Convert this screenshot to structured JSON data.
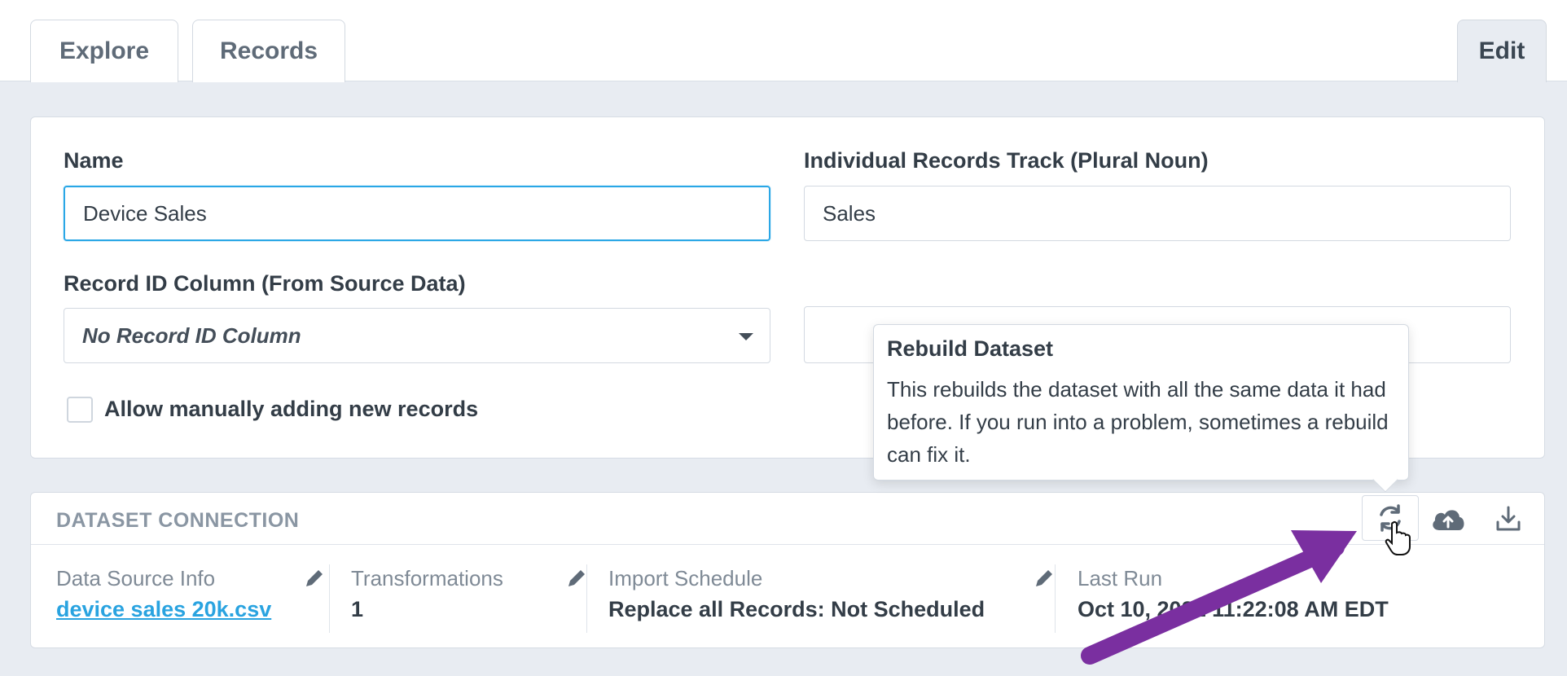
{
  "tabs": [
    {
      "label": "Explore"
    },
    {
      "label": "Records"
    },
    {
      "label": "Edit"
    }
  ],
  "form": {
    "name_label": "Name",
    "name_value": "Device Sales",
    "records_track_label": "Individual Records Track (Plural Noun)",
    "records_track_value": "Sales",
    "record_id_label": "Record ID Column (From Source Data)",
    "record_id_value": "No Record ID Column",
    "allow_manual_label": "Allow manually adding new records"
  },
  "connection": {
    "title": "DATASET CONNECTION",
    "data_source_caption": "Data Source Info",
    "data_source_value": "device sales 20k.csv",
    "transformations_caption": "Transformations",
    "transformations_value": "1",
    "import_schedule_caption": "Import Schedule",
    "import_schedule_value": "Replace all Records: Not Scheduled",
    "last_run_caption": "Last Run",
    "last_run_value": "Oct 10, 2021 11:22:08 AM EDT",
    "actions": [
      {
        "icon": "refresh-icon"
      },
      {
        "icon": "cloud-upload-icon"
      },
      {
        "icon": "download-icon"
      }
    ]
  },
  "tooltip": {
    "title": "Rebuild Dataset",
    "body": "This rebuilds the dataset with all the same data it had before. If you run into a problem, sometimes a rebuild can fix it."
  },
  "colors": {
    "accent": "#29a3e0",
    "annotation_arrow": "#7a2fa0",
    "page_bg": "#e8ecf2"
  }
}
